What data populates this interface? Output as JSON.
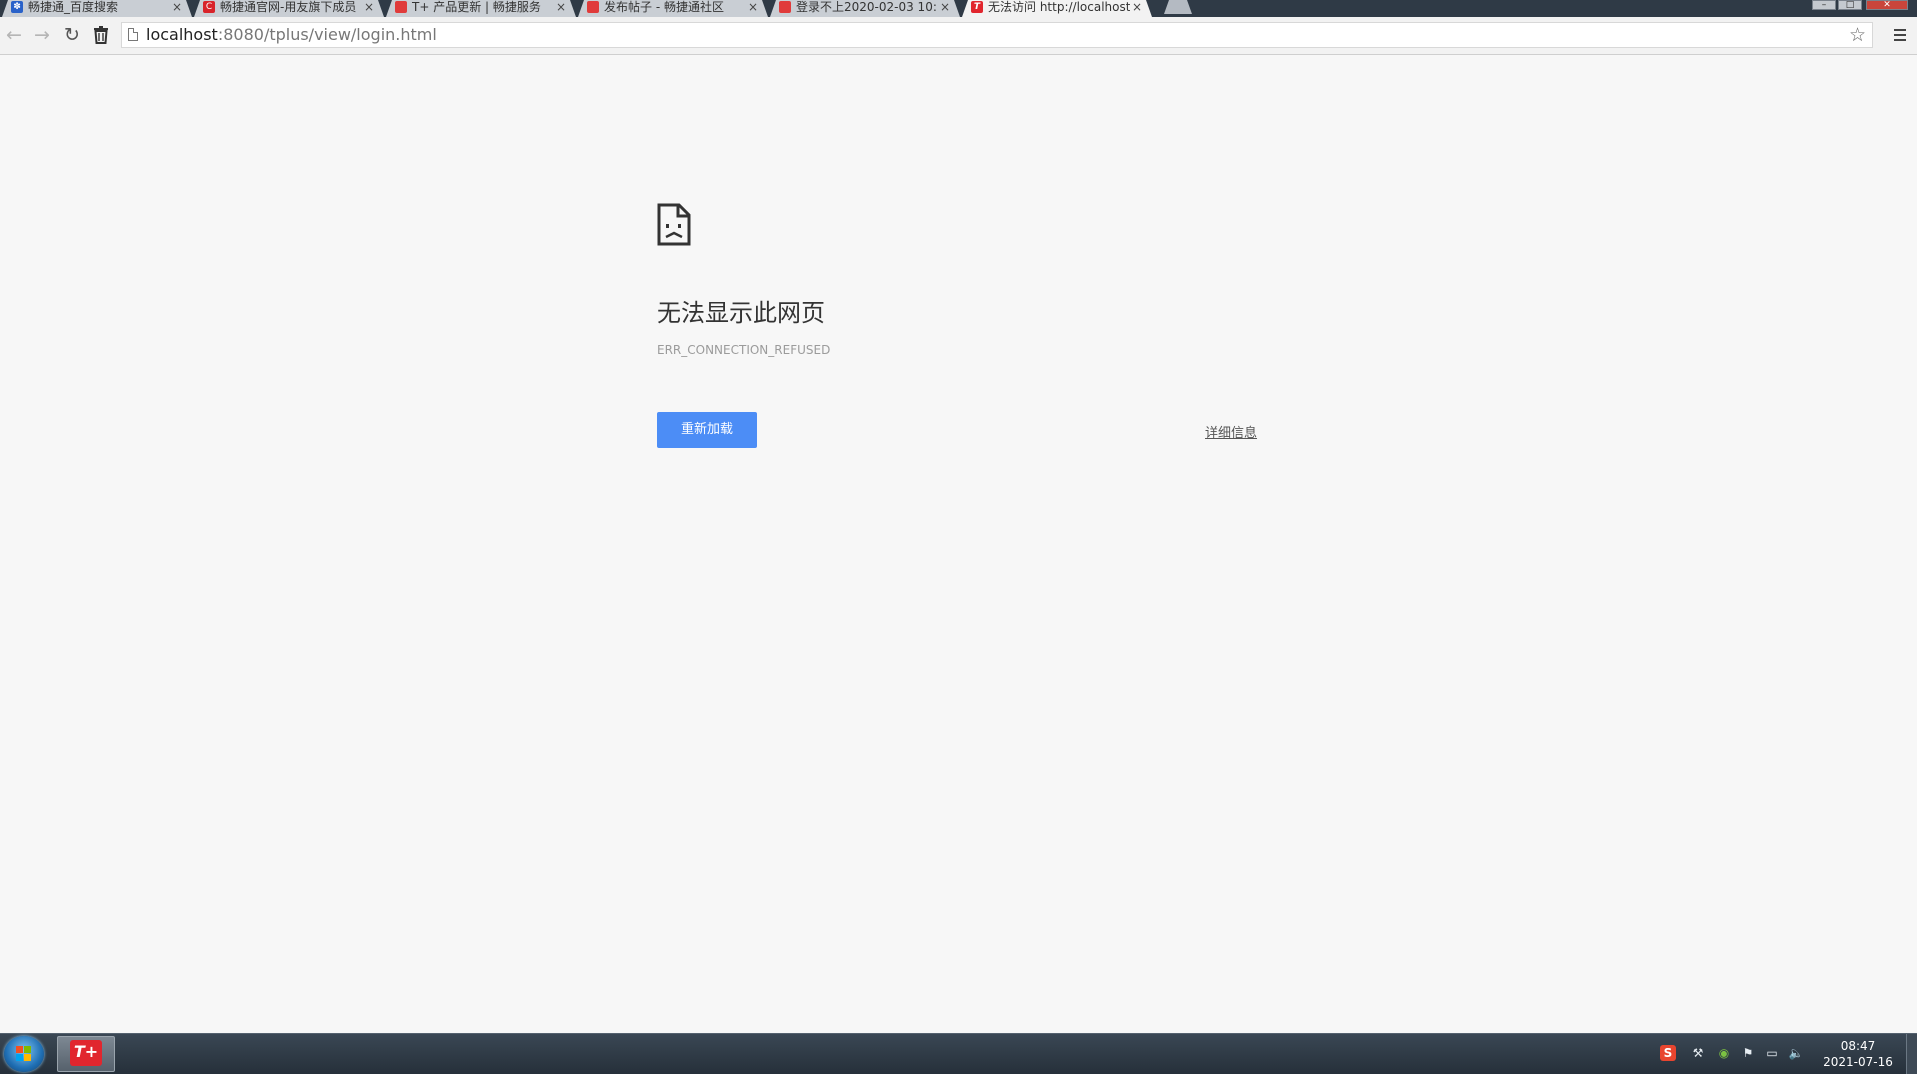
{
  "browser": {
    "tabs": [
      {
        "title": "畅捷通_百度搜索",
        "favicon": "paw-icon",
        "favicon_color": "#2a62c9",
        "active": false
      },
      {
        "title": "畅捷通官网-用友旗下成员",
        "favicon": "c-logo-icon",
        "favicon_color": "#d8232a",
        "active": false
      },
      {
        "title": "T+ 产品更新 | 畅捷服务",
        "favicon": "chanjet-icon",
        "favicon_color": "#e03b3b",
        "active": false
      },
      {
        "title": "发布帖子 - 畅捷通社区",
        "favicon": "chanjet-icon",
        "favicon_color": "#e03b3b",
        "active": false
      },
      {
        "title": "登录不上2020-02-03 10:",
        "favicon": "chanjet-icon",
        "favicon_color": "#e03b3b",
        "active": false
      },
      {
        "title": "无法访问 http://localhost",
        "favicon": "tplus-icon",
        "favicon_color": "#e1262e",
        "active": true
      }
    ],
    "close_glyph": "×",
    "window_controls": {
      "minimize": "–",
      "maximize": "□",
      "close": "✕"
    },
    "url_host": "localhost",
    "url_rest": ":8080/tplus/view/login.html"
  },
  "error_page": {
    "heading": "无法显示此网页",
    "code": "ERR_CONNECTION_REFUSED",
    "reload_label": "重新加载",
    "details_label": "详细信息"
  },
  "taskbar": {
    "pinned_app_label": "T+",
    "clock_time": "08:47",
    "clock_date": "2021-07-16",
    "tray_icons": [
      "sogou-ime-icon",
      "network-tool-icon",
      "nvidia-icon",
      "action-center-flag-icon",
      "network-icon",
      "volume-icon"
    ]
  },
  "colors": {
    "accent_button": "#4c8df6",
    "page_background": "#f7f7f7",
    "taskbar_background": "#26303a",
    "tplus_brand": "#e1262e"
  }
}
